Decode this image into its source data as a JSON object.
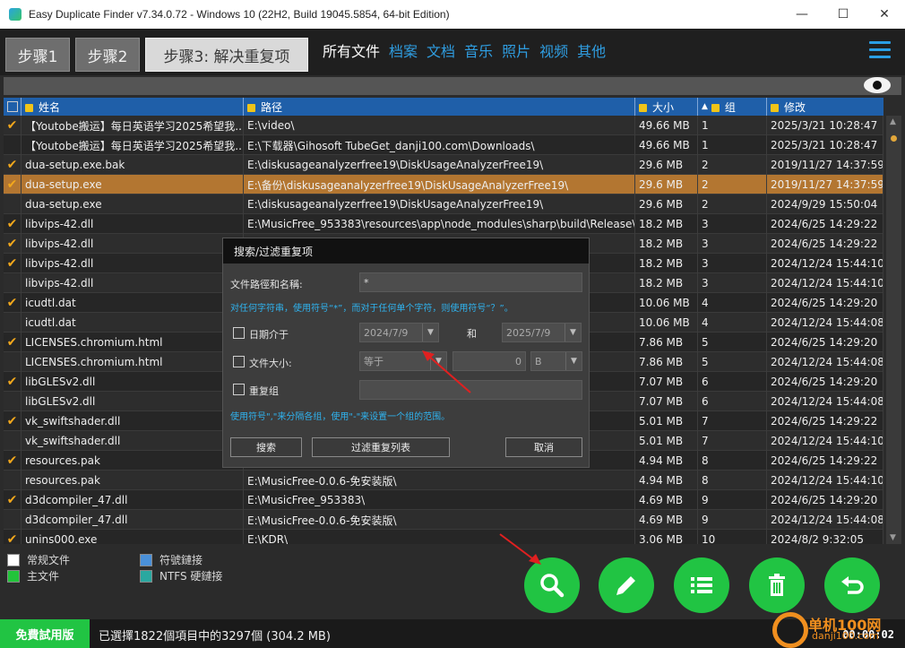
{
  "window": {
    "title": "Easy Duplicate Finder v7.34.0.72 - Windows 10 (22H2, Build 19045.5854, 64-bit Edition)",
    "minimize_glyph": "—",
    "maximize_glyph": "☐",
    "close_glyph": "✕"
  },
  "steps": [
    {
      "label": "步骤1"
    },
    {
      "label": "步骤2"
    },
    {
      "label": "步骤3: 解决重复项"
    }
  ],
  "filter_tabs": [
    {
      "label": "所有文件"
    },
    {
      "label": "档案"
    },
    {
      "label": "文档"
    },
    {
      "label": "音乐"
    },
    {
      "label": "照片"
    },
    {
      "label": "视频"
    },
    {
      "label": "其他"
    }
  ],
  "table": {
    "headers": {
      "name": "姓名",
      "path": "路径",
      "size": "大小",
      "group": "组",
      "modified": "修改"
    },
    "check_glyph": "✔",
    "sort_glyph": "▲",
    "rows": [
      {
        "check": true,
        "name": "【Youtobe搬运】每日英语学习2025希望我...",
        "path": "E:\\video\\",
        "size": "49.66 MB",
        "group": "1",
        "modified": "2025/3/21 10:28:47"
      },
      {
        "check": false,
        "name": "【Youtobe搬运】每日英语学习2025希望我...",
        "path": "E:\\下载器\\Gihosoft TubeGet_danji100.com\\Downloads\\",
        "size": "49.66 MB",
        "group": "1",
        "modified": "2025/3/21 10:28:47"
      },
      {
        "check": true,
        "name": "dua-setup.exe.bak",
        "path": "E:\\diskusageanalyzerfree19\\DiskUsageAnalyzerFree19\\",
        "size": "29.6 MB",
        "group": "2",
        "modified": "2019/11/27 14:37:59"
      },
      {
        "check": true,
        "name": "dua-setup.exe",
        "path": "E:\\备份\\diskusageanalyzerfree19\\DiskUsageAnalyzerFree19\\",
        "size": "29.6 MB",
        "group": "2",
        "modified": "2019/11/27 14:37:59",
        "selected": true
      },
      {
        "check": false,
        "name": "dua-setup.exe",
        "path": "E:\\diskusageanalyzerfree19\\DiskUsageAnalyzerFree19\\",
        "size": "29.6 MB",
        "group": "2",
        "modified": "2024/9/29 15:50:04"
      },
      {
        "check": true,
        "name": "libvips-42.dll",
        "path": "E:\\MusicFree_953383\\resources\\app\\node_modules\\sharp\\build\\Release\\",
        "size": "18.2 MB",
        "group": "3",
        "modified": "2024/6/25 14:29:22"
      },
      {
        "check": true,
        "name": "libvips-42.dll",
        "path": "5\\win3...",
        "size": "18.2 MB",
        "group": "3",
        "modified": "2024/6/25 14:29:22"
      },
      {
        "check": true,
        "name": "libvips-42.dll",
        "path": "Release\\",
        "size": "18.2 MB",
        "group": "3",
        "modified": "2024/12/24 15:44:10"
      },
      {
        "check": false,
        "name": "libvips-42.dll",
        "path": "r\\8.14....",
        "size": "18.2 MB",
        "group": "3",
        "modified": "2024/12/24 15:44:10"
      },
      {
        "check": true,
        "name": "icudtl.dat",
        "path": "",
        "size": "10.06 MB",
        "group": "4",
        "modified": "2024/6/25 14:29:20"
      },
      {
        "check": false,
        "name": "icudtl.dat",
        "path": "",
        "size": "10.06 MB",
        "group": "4",
        "modified": "2024/12/24 15:44:08"
      },
      {
        "check": true,
        "name": "LICENSES.chromium.html",
        "path": "",
        "size": "7.86 MB",
        "group": "5",
        "modified": "2024/6/25 14:29:20"
      },
      {
        "check": false,
        "name": "LICENSES.chromium.html",
        "path": "",
        "size": "7.86 MB",
        "group": "5",
        "modified": "2024/12/24 15:44:08"
      },
      {
        "check": true,
        "name": "libGLESv2.dll",
        "path": "",
        "size": "7.07 MB",
        "group": "6",
        "modified": "2024/6/25 14:29:20"
      },
      {
        "check": false,
        "name": "libGLESv2.dll",
        "path": "",
        "size": "7.07 MB",
        "group": "6",
        "modified": "2024/12/24 15:44:08"
      },
      {
        "check": true,
        "name": "vk_swiftshader.dll",
        "path": "",
        "size": "5.01 MB",
        "group": "7",
        "modified": "2024/6/25 14:29:22"
      },
      {
        "check": false,
        "name": "vk_swiftshader.dll",
        "path": "",
        "size": "5.01 MB",
        "group": "7",
        "modified": "2024/12/24 15:44:10"
      },
      {
        "check": true,
        "name": "resources.pak",
        "path": "",
        "size": "4.94 MB",
        "group": "8",
        "modified": "2024/6/25 14:29:22"
      },
      {
        "check": false,
        "name": "resources.pak",
        "path": "E:\\MusicFree-0.0.6-免安装版\\",
        "size": "4.94 MB",
        "group": "8",
        "modified": "2024/12/24 15:44:10"
      },
      {
        "check": true,
        "name": "d3dcompiler_47.dll",
        "path": "E:\\MusicFree_953383\\",
        "size": "4.69 MB",
        "group": "9",
        "modified": "2024/6/25 14:29:20"
      },
      {
        "check": false,
        "name": "d3dcompiler_47.dll",
        "path": "E:\\MusicFree-0.0.6-免安装版\\",
        "size": "4.69 MB",
        "group": "9",
        "modified": "2024/12/24 15:44:08"
      },
      {
        "check": true,
        "name": "unins000.exe",
        "path": "E:\\KDR\\",
        "size": "3.06 MB",
        "group": "10",
        "modified": "2024/8/2 9:32:05"
      }
    ]
  },
  "legend": {
    "regular": "常规文件",
    "main": "主文件",
    "symlink": "符號鏈接",
    "ntfs": "NTFS 硬鏈接",
    "colors": {
      "regular": "#ffffff",
      "main": "#22c43a",
      "symlink": "#4a90d9",
      "ntfs": "#2aa8a0"
    }
  },
  "dialog": {
    "title": "搜索/过滤重复项",
    "path_label": "文件路徑和名稱:",
    "path_value": "*",
    "hint1": "对任何字符串，使用符号“*”，而对于任何单个字符，则使用符号“？”。",
    "date_label": "日期介于",
    "date_from": "2024/7/9",
    "and_label": "和",
    "date_to": "2025/7/9",
    "size_label": "文件大小:",
    "size_op": "等于",
    "size_value": "0",
    "size_unit": "B",
    "dup_label": "重复组",
    "hint2": "使用符号\",\"来分隔各组，使用\"-\"来设置一个组的范围。",
    "search_btn": "搜索",
    "filter_btn": "过滤重复列表",
    "cancel_btn": "取消"
  },
  "actions": [
    "search-icon",
    "edit-icon",
    "list-icon",
    "trash-icon",
    "undo-icon"
  ],
  "status": {
    "trial": "免費試用版",
    "text": "已選擇1822個項目中的3297個 (304.2 MB)",
    "timer": "00:00:02"
  },
  "watermark": {
    "main": "单机100网",
    "sub": "danji100.com"
  },
  "colors": {
    "accent": "#21c443",
    "header_blue": "#1f5fa9",
    "selected_row": "#b37631",
    "link_blue": "#2f9de0",
    "check_orange": "#f3a81c"
  }
}
